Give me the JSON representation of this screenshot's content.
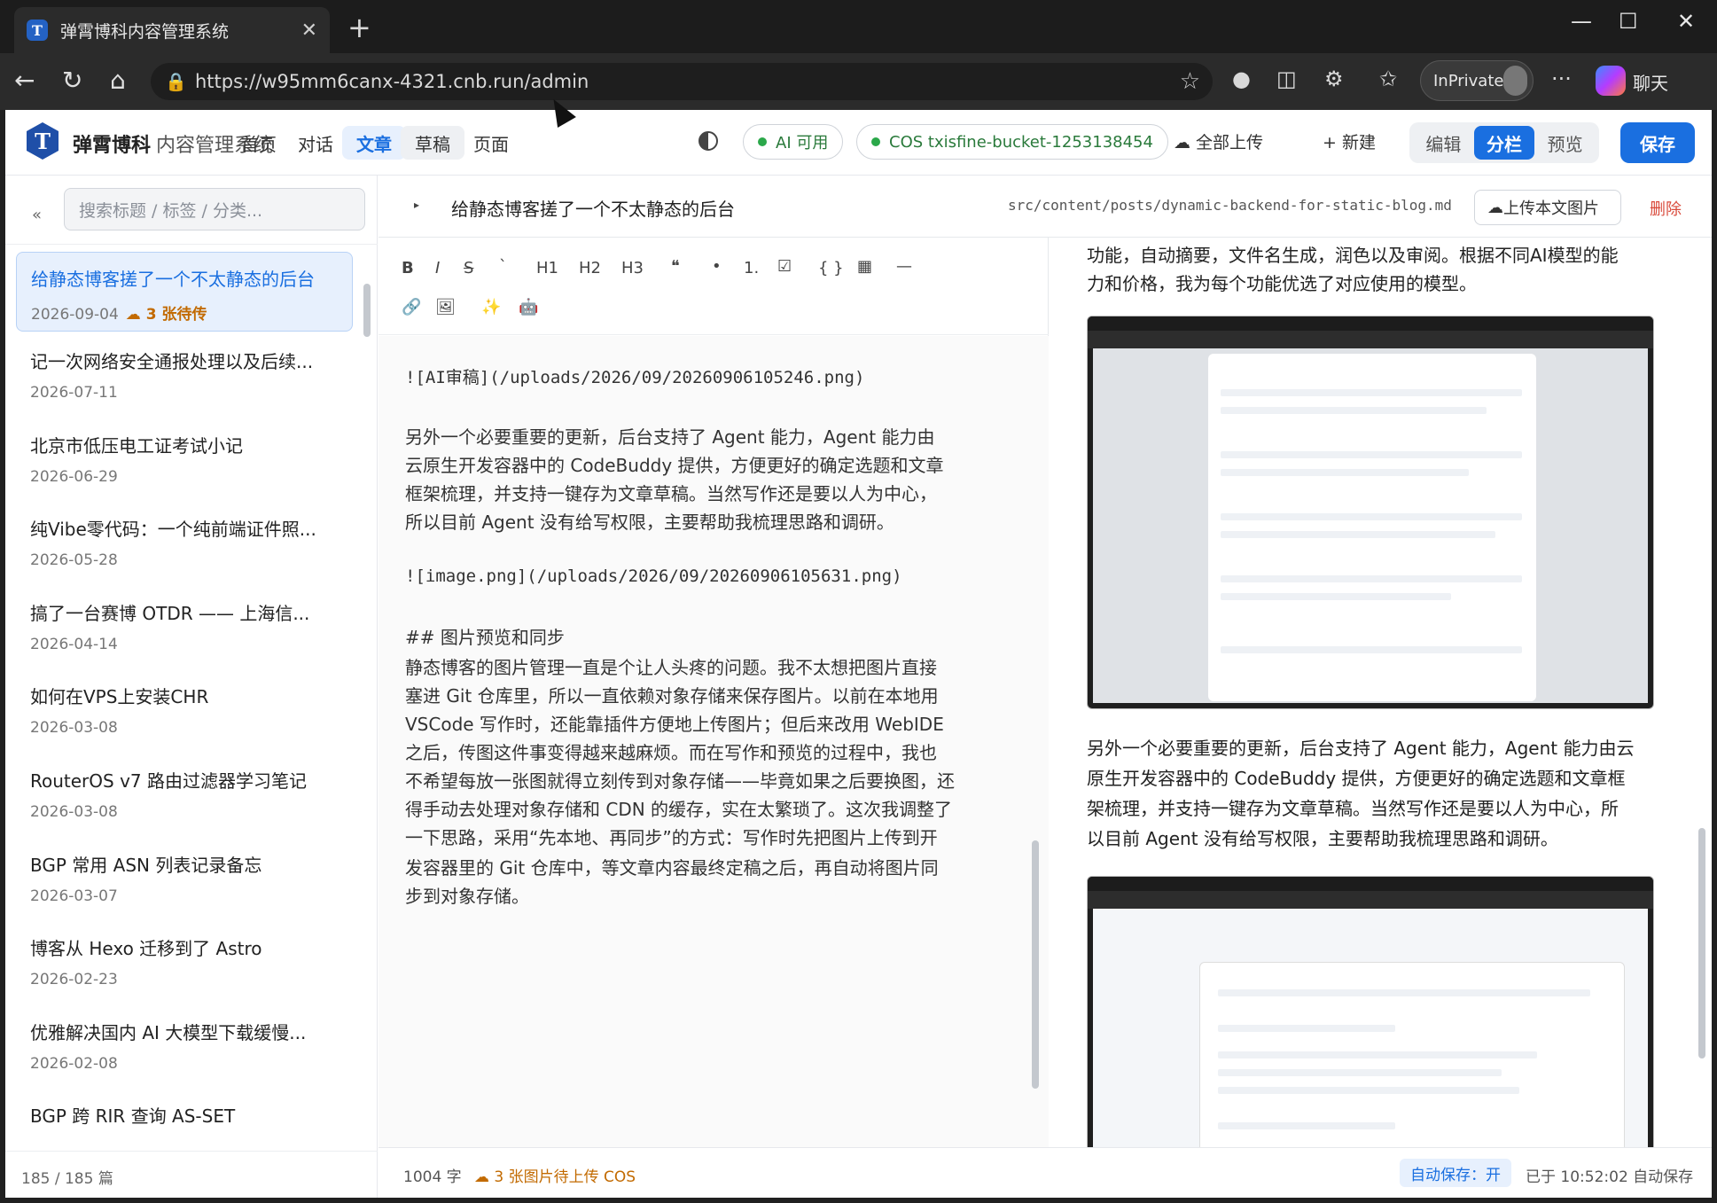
{
  "browser": {
    "tab_title": "弹霄博科内容管理系统",
    "url": "https://w95mm6canx-4321.cnb.run/admin",
    "inprivate_label": "InPrivate",
    "chat_label": "聊天"
  },
  "header": {
    "brand_bold": "弹霄博科",
    "brand_rest": "内容管理系统",
    "nav": [
      "首页",
      "对话",
      "文章",
      "草稿",
      "页面"
    ],
    "ai_status": "AI 可用",
    "cos_status": "COS txisfine-bucket-1253138454",
    "upload_all": "全部上传",
    "new_label": "+ 新建",
    "modes": [
      "编辑",
      "分栏",
      "预览"
    ],
    "save_label": "保存"
  },
  "sidebar": {
    "collapse_icon": "«",
    "search_placeholder": "搜索标题 / 标签 / 分类...",
    "posts": [
      {
        "title": "给静态博客搓了一个不太静态的后台",
        "date": "2026-09-04",
        "pending": "3 张待传"
      },
      {
        "title": "记一次网络安全通报处理以及后续...",
        "date": "2026-07-11"
      },
      {
        "title": "北京市低压电工证考试小记",
        "date": "2026-06-29"
      },
      {
        "title": "纯Vibe零代码：一个纯前端证件照...",
        "date": "2026-05-28"
      },
      {
        "title": "搞了一台赛博 OTDR —— 上海信...",
        "date": "2026-04-14"
      },
      {
        "title": "如何在VPS上安装CHR",
        "date": "2026-03-08"
      },
      {
        "title": "RouterOS v7 路由过滤器学习笔记",
        "date": "2026-03-08"
      },
      {
        "title": "BGP 常用 ASN 列表记录备忘",
        "date": "2026-03-07"
      },
      {
        "title": "博客从 Hexo 迁移到了 Astro",
        "date": "2026-02-23"
      },
      {
        "title": "优雅解决国内 AI 大模型下载缓慢...",
        "date": "2026-02-08"
      },
      {
        "title": "BGP 跨 RIR 查询 AS-SET",
        "date": "2026-02-08"
      }
    ],
    "count": "185 / 185 篇"
  },
  "editor_header": {
    "title": "给静态博客搓了一个不太静态的后台",
    "path": "src/content/posts/dynamic-backend-for-static-blog.md",
    "upload_btn": "上传本文图片",
    "delete_btn": "删除"
  },
  "toolbar": {
    "row1": [
      "B",
      "I",
      "S",
      "`",
      "H1",
      "H2",
      "H3",
      "❝",
      "•",
      "1.",
      "☑",
      "{ }",
      "▦",
      "—"
    ],
    "row2_icons": [
      "link-icon",
      "image-icon",
      "sparkle-icon",
      "emoji-icon"
    ]
  },
  "editor_lines": [
    "![AI审稿](/uploads/2026/09/20260906105246.png)",
    "另外一个必要重要的更新，后台支持了 Agent 能力，Agent 能力由",
    "云原生开发容器中的 CodeBuddy 提供，方便更好的确定选题和文章",
    "框架梳理，并支持一键存为文章草稿。当然写作还是要以人为中心，",
    "所以目前 Agent 没有给写权限，主要帮助我梳理思路和调研。",
    "![image.png](/uploads/2026/09/20260906105631.png)",
    "## 图片预览和同步",
    "静态博客的图片管理一直是个让人头疼的问题。我不太想把图片直接",
    "塞进 Git 仓库里，所以一直依赖对象存储来保存图片。以前在本地用",
    "VSCode 写作时，还能靠插件方便地上传图片；但后来改用 WebIDE",
    "之后，传图这件事变得越来越麻烦。而在写作和预览的过程中，我也",
    "不希望每放一张图就得立刻传到对象存储——毕竟如果之后要换图，还",
    "得手动去处理对象存储和 CDN 的缓存，实在太繁琐了。这次我调整了",
    "一下思路，采用“先本地、再同步”的方式：写作时先把图片上传到开",
    "发容器里的 Git 仓库中，等文章内容最终定稿之后，再自动将图片同",
    "步到对象存储。"
  ],
  "preview_lines": {
    "top": [
      "功能，自动摘要，文件名生成，润色以及审阅。根据不同AI模型的能",
      "力和价格，我为每个功能优选了对应使用的模型。"
    ],
    "middle": [
      "另外一个必要重要的更新，后台支持了 Agent 能力，Agent 能力由云",
      "原生开发容器中的 CodeBuddy 提供，方便更好的确定选题和文章框",
      "架梳理，并支持一键存为文章草稿。当然写作还是要以人为中心，所",
      "以目前 Agent 没有给写权限，主要帮助我梳理思路和调研。"
    ]
  },
  "status": {
    "words": "1004 字",
    "pending": "3 张图片待上传 COS",
    "autosave": "自动保存：开",
    "saved": "已于 10:52:02 自动保存"
  }
}
